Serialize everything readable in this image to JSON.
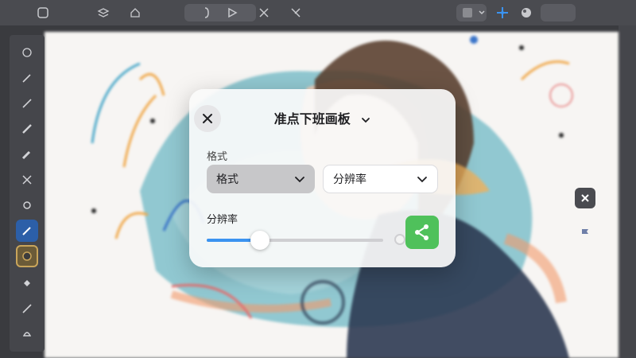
{
  "modal": {
    "title": "准点下班画板",
    "format_section_label": "格式",
    "format_select_value": "格式",
    "resolution_select_value": "分辨率",
    "resolution_label": "分辨率",
    "resolution_slider_level": 0.3
  },
  "colors": {
    "accent_blue": "#3b93f0",
    "share_green": "#4fc15b",
    "toolbar_bg": "#4a4b50",
    "canvas_bg": "#f6f4f2"
  },
  "icons": {
    "close": "close-icon",
    "title_chevron": "chevron-down-icon",
    "select_chevron": "chevron-down-icon",
    "share": "share-icon"
  }
}
